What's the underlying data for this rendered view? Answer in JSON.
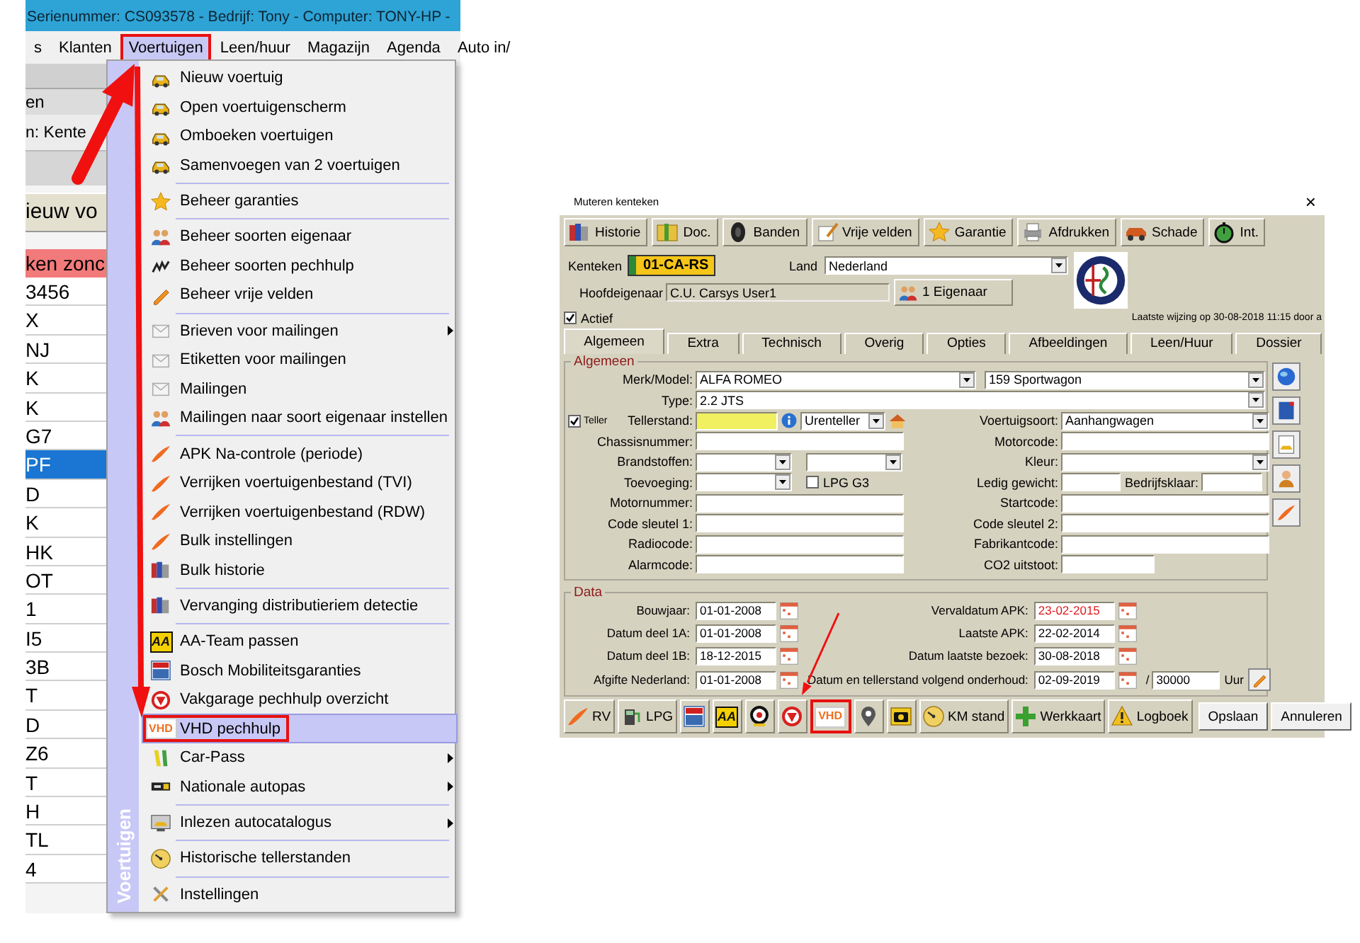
{
  "app": {
    "title": "Serienummer: CS093578 - Bedrijf: Tony - Computer: TONY-HP -",
    "menubar": [
      {
        "label": "s",
        "selected": false,
        "annotated": false
      },
      {
        "label": "Klanten",
        "selected": false,
        "annotated": false
      },
      {
        "label": "Voertuigen",
        "selected": true,
        "annotated": true
      },
      {
        "label": "Leen/huur",
        "selected": false,
        "annotated": false
      },
      {
        "label": "Magazijn",
        "selected": false,
        "annotated": false
      },
      {
        "label": "Agenda",
        "selected": false,
        "annotated": false
      },
      {
        "label": "Auto in/",
        "selected": false,
        "annotated": false
      }
    ],
    "background": {
      "texts": [
        "en",
        "n: Kente"
      ],
      "button": "ieuw vo",
      "banner": "ken zonc",
      "rows": [
        {
          "text": "3456",
          "selected": false
        },
        {
          "text": "X",
          "selected": false
        },
        {
          "text": "NJ",
          "selected": false
        },
        {
          "text": "K",
          "selected": false
        },
        {
          "text": "K",
          "selected": false
        },
        {
          "text": "G7",
          "selected": false
        },
        {
          "text": "PF",
          "selected": true
        },
        {
          "text": "D",
          "selected": false
        },
        {
          "text": "K",
          "selected": false
        },
        {
          "text": "HK",
          "selected": false
        },
        {
          "text": "OT",
          "selected": false
        },
        {
          "text": "1",
          "selected": false
        },
        {
          "text": "I5",
          "selected": false
        },
        {
          "text": "3B",
          "selected": false
        },
        {
          "text": "T",
          "selected": false
        },
        {
          "text": "D",
          "selected": false
        },
        {
          "text": "Z6",
          "selected": false
        },
        {
          "text": "T",
          "selected": false
        },
        {
          "text": "H",
          "selected": false
        },
        {
          "text": "TL",
          "selected": false
        },
        {
          "text": "4",
          "selected": false
        }
      ]
    },
    "menu": {
      "side_title": "Voertuigen",
      "groups": [
        [
          {
            "label": "Nieuw voertuig",
            "submenu": false,
            "selected": false,
            "annotated": false
          },
          {
            "label": "Open voertuigenscherm",
            "submenu": false,
            "selected": false,
            "annotated": false
          },
          {
            "label": "Omboeken voertuigen",
            "submenu": false,
            "selected": false,
            "annotated": false
          },
          {
            "label": "Samenvoegen van 2 voertuigen",
            "submenu": false,
            "selected": false,
            "annotated": false
          }
        ],
        [
          {
            "label": "Beheer garanties",
            "submenu": false,
            "selected": false,
            "annotated": false
          }
        ],
        [
          {
            "label": "Beheer soorten eigenaar",
            "submenu": false,
            "selected": false,
            "annotated": false
          },
          {
            "label": "Beheer soorten pechhulp",
            "submenu": false,
            "selected": false,
            "annotated": false
          },
          {
            "label": "Beheer vrije velden",
            "submenu": false,
            "selected": false,
            "annotated": false
          }
        ],
        [
          {
            "label": "Brieven voor mailingen",
            "submenu": true,
            "selected": false,
            "annotated": false
          },
          {
            "label": "Etiketten voor mailingen",
            "submenu": false,
            "selected": false,
            "annotated": false
          },
          {
            "label": "Mailingen",
            "submenu": false,
            "selected": false,
            "annotated": false
          },
          {
            "label": "Mailingen naar soort eigenaar instellen",
            "submenu": false,
            "selected": false,
            "annotated": false
          }
        ],
        [
          {
            "label": "APK Na-controle (periode)",
            "submenu": false,
            "selected": false,
            "annotated": false
          },
          {
            "label": "Verrijken voertuigenbestand (TVI)",
            "submenu": false,
            "selected": false,
            "annotated": false
          },
          {
            "label": "Verrijken voertuigenbestand (RDW)",
            "submenu": false,
            "selected": false,
            "annotated": false
          },
          {
            "label": "Bulk instellingen",
            "submenu": false,
            "selected": false,
            "annotated": false
          },
          {
            "label": "Bulk historie",
            "submenu": false,
            "selected": false,
            "annotated": false
          }
        ],
        [
          {
            "label": "Vervanging distributieriem detectie",
            "submenu": false,
            "selected": false,
            "annotated": false
          }
        ],
        [
          {
            "label": "AA-Team passen",
            "submenu": false,
            "selected": false,
            "annotated": false,
            "icon_text": "AA"
          },
          {
            "label": "Bosch Mobiliteitsgaranties",
            "submenu": false,
            "selected": false,
            "annotated": false
          },
          {
            "label": "Vakgarage pechhulp overzicht",
            "submenu": false,
            "selected": false,
            "annotated": false
          },
          {
            "label": "VHD pechhulp",
            "submenu": false,
            "selected": true,
            "annotated": true,
            "icon_text": "VHD"
          },
          {
            "label": "Car-Pass",
            "submenu": true,
            "selected": false,
            "annotated": false
          },
          {
            "label": "Nationale autopas",
            "submenu": true,
            "selected": false,
            "annotated": false
          }
        ],
        [
          {
            "label": "Inlezen autocatalogus",
            "submenu": true,
            "selected": false,
            "annotated": false
          }
        ],
        [
          {
            "label": "Historische tellerstanden",
            "submenu": false,
            "selected": false,
            "annotated": false
          }
        ],
        [
          {
            "label": "Instellingen",
            "submenu": false,
            "selected": false,
            "annotated": false
          }
        ]
      ]
    }
  },
  "dialog": {
    "title": "Muteren kenteken",
    "close": "×",
    "toolbar": [
      {
        "label": "Historie"
      },
      {
        "label": "Doc."
      },
      {
        "label": "Banden"
      },
      {
        "label": "Vrije velden"
      },
      {
        "label": "Garantie"
      },
      {
        "label": "Afdrukken"
      },
      {
        "label": "Schade"
      },
      {
        "label": "Int."
      }
    ],
    "kenteken": {
      "label": "Kenteken",
      "plate": "01-CA-RS"
    },
    "land": {
      "label": "Land",
      "value": "Nederland"
    },
    "owner": {
      "label": "Hoofdeigenaar",
      "value": "C.U. Carsys User1",
      "button": "1 Eigenaar"
    },
    "actief": {
      "label": "Actief",
      "checked": true
    },
    "last_change": "Laatste wijzing op 30-08-2018 11:15 door a",
    "tabs": [
      {
        "label": "Algemeen",
        "selected": true
      },
      {
        "label": "Extra",
        "selected": false
      },
      {
        "label": "Technisch",
        "selected": false
      },
      {
        "label": "Overig",
        "selected": false
      },
      {
        "label": "Opties",
        "selected": false
      },
      {
        "label": "Afbeeldingen",
        "selected": false
      },
      {
        "label": "Leen/Huur",
        "selected": false
      },
      {
        "label": "Dossier",
        "selected": false
      }
    ],
    "general": {
      "title": "Algemeen",
      "merk": {
        "label": "Merk/Model:",
        "make": "ALFA ROMEO",
        "model": "159 Sportwagon"
      },
      "type": {
        "label": "Type:",
        "value": "2.2 JTS"
      },
      "teller": {
        "check": {
          "label": "Teller",
          "checked": true
        },
        "label": "Tellerstand:",
        "unit": "Urenteller"
      },
      "vehicle_type": {
        "label": "Voertuigsoort:",
        "value": "Aanhangwagen"
      },
      "rows": [
        {
          "left": {
            "label": "Chassisnummer:",
            "kind": "text"
          },
          "right": {
            "label": "Motorcode:",
            "kind": "text"
          }
        },
        {
          "left": {
            "label": "Brandstoffen:",
            "kind": "dual_select"
          },
          "right": {
            "label": "Kleur:",
            "kind": "select"
          }
        },
        {
          "left": {
            "label": "Toevoeging:",
            "kind": "select_check",
            "check": {
              "label": "LPG G3",
              "checked": false
            }
          },
          "right": {
            "label": "Ledig gewicht:",
            "kind": "pair",
            "second_label": "Bedrijfsklaar:"
          }
        },
        {
          "left": {
            "label": "Motornummer:",
            "kind": "text"
          },
          "right": {
            "label": "Startcode:",
            "kind": "text"
          }
        },
        {
          "left": {
            "label": "Code sleutel 1:",
            "kind": "text"
          },
          "right": {
            "label": "Code sleutel 2:",
            "kind": "text"
          }
        },
        {
          "left": {
            "label": "Radiocode:",
            "kind": "text"
          },
          "right": {
            "label": "Fabrikantcode:",
            "kind": "text"
          }
        },
        {
          "left": {
            "label": "Alarmcode:",
            "kind": "text"
          },
          "right": {
            "label": "CO2 uitstoot:",
            "kind": "short"
          }
        }
      ]
    },
    "dates": {
      "title": "Data",
      "rows": [
        {
          "left": {
            "label": "Bouwjaar:",
            "value": "01-01-2008"
          },
          "right": {
            "label": "Vervaldatum APK:",
            "value": "23-02-2015",
            "overdue": true
          }
        },
        {
          "left": {
            "label": "Datum deel 1A:",
            "value": "01-01-2008"
          },
          "right": {
            "label": "Laatste APK:",
            "value": "22-02-2014",
            "overdue": false
          }
        },
        {
          "left": {
            "label": "Datum deel 1B:",
            "value": "18-12-2015"
          },
          "right": {
            "label": "Datum laatste bezoek:",
            "value": "30-08-2018",
            "overdue": false
          }
        },
        {
          "left": {
            "label": "Afgifte Nederland:",
            "value": "01-01-2008"
          },
          "right": {
            "label": "Datum en tellerstand volgend onderhoud:",
            "value": "02-09-2019",
            "overdue": false,
            "separator": "/",
            "count": "30000",
            "unit": "Uur"
          }
        }
      ]
    },
    "bottom": [
      {
        "kind": "labeled",
        "label": "RV",
        "annotated": false
      },
      {
        "kind": "labeled",
        "label": "LPG",
        "annotated": false
      },
      {
        "kind": "icon",
        "annotated": false
      },
      {
        "kind": "badge",
        "text": "AA",
        "annotated": false
      },
      {
        "kind": "icon",
        "annotated": false
      },
      {
        "kind": "icon",
        "annotated": false
      },
      {
        "kind": "badge",
        "text": "VHD",
        "annotated": true
      },
      {
        "kind": "icon",
        "annotated": false
      },
      {
        "kind": "icon",
        "annotated": false
      },
      {
        "kind": "labeled",
        "label": "KM stand",
        "annotated": false
      },
      {
        "kind": "labeled",
        "label": "Werkkaart",
        "annotated": false
      },
      {
        "kind": "labeled",
        "label": "Logboek",
        "annotated": false
      }
    ],
    "buttons": [
      "Opslaan",
      "Annuleren"
    ]
  }
}
